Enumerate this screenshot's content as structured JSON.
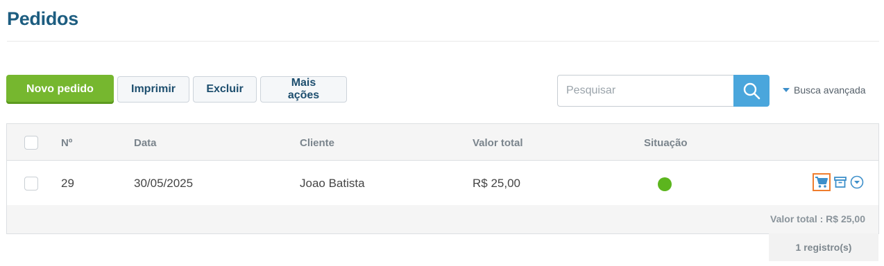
{
  "page": {
    "title": "Pedidos"
  },
  "toolbar": {
    "new_label": "Novo pedido",
    "print_label": "Imprimir",
    "delete_label": "Excluir",
    "more_label": "Mais ações"
  },
  "search": {
    "placeholder": "Pesquisar",
    "value": "",
    "advanced_label": "Busca avançada"
  },
  "table": {
    "columns": [
      "Nº",
      "Data",
      "Cliente",
      "Valor total",
      "Situação"
    ],
    "rows": [
      {
        "number": "29",
        "date": "30/05/2025",
        "client": "Joao Batista",
        "total": "R$ 25,00",
        "status_color": "#5cb51e"
      }
    ],
    "footer_total": "Valor total : R$ 25,00"
  },
  "pagination": {
    "records": "1 registro(s)"
  },
  "colors": {
    "primary_green": "#76b72f",
    "title_blue": "#1d5d80",
    "search_blue": "#4aa6dc",
    "highlight_orange": "#ef7d2d",
    "status_green": "#5cb51e"
  },
  "icons": [
    "search-icon",
    "caret-down-icon",
    "cart-icon",
    "archive-icon",
    "chevron-down-circle-icon"
  ]
}
